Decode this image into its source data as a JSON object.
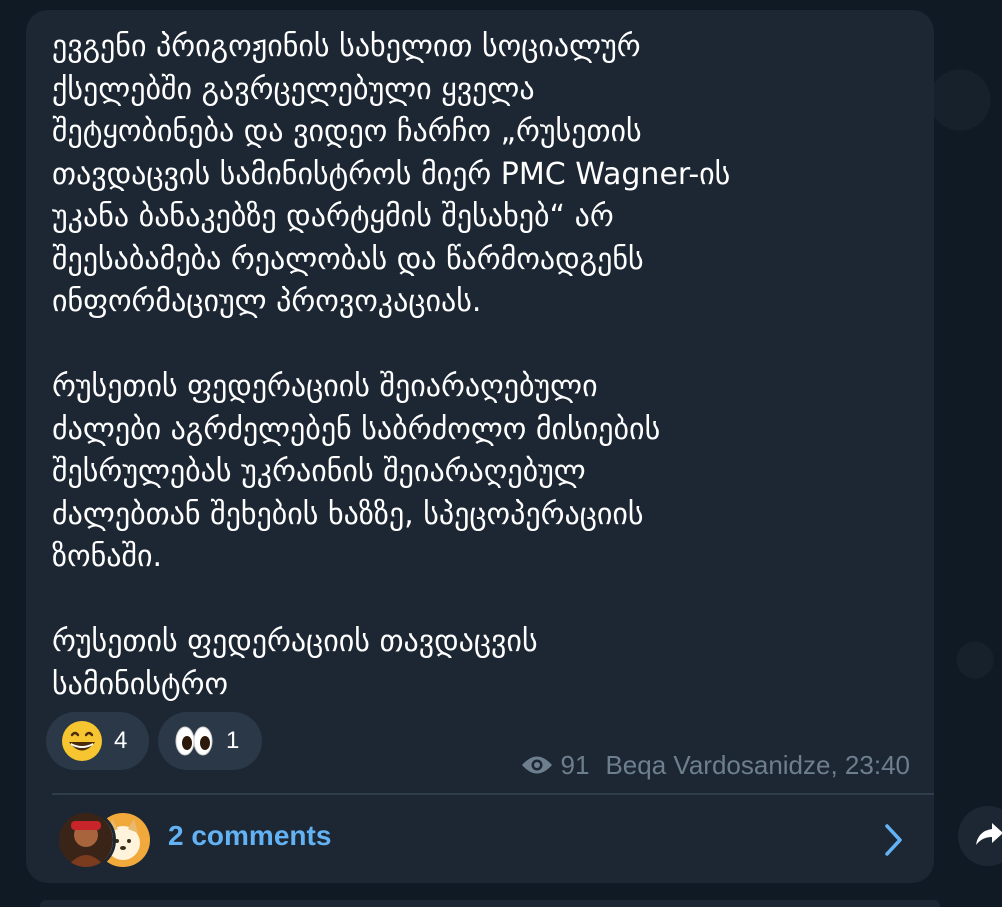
{
  "message": {
    "text": "ევგენი პრიგოჟინის სახელით სოციალურ\nქსელებში გავრცელებული ყველა\nშეტყობინება და ვიდეო ჩარჩო „რუსეთის\nთავდაცვის სამინისტროს მიერ PMC Wagner-ის\nუკანა ბანაკებზე დარტყმის შესახებ“ არ\nშეესაბამება რეალობას და წარმოადგენს\nინფორმაციულ პროვოკაციას.\n\nრუსეთის ფედერაციის შეიარაღებული\nძალები აგრძელებენ საბრძოლო მისიების\nშესრულებას უკრაინის შეიარაღებულ\nძალებთან შეხების ხაზზე, სპეცოპერაციის\nზონაში.\n\nრუსეთის ფედერაციის თავდაცვის\nსამინისტრო"
  },
  "reactions": [
    {
      "icon": "grinning-face-emoji",
      "count": "4"
    },
    {
      "icon": "eyes-emoji",
      "count": "1"
    }
  ],
  "meta": {
    "views": "91",
    "author_time": "Beqa Vardosanidze, 23:40"
  },
  "comments": {
    "label": "2 comments"
  },
  "colors": {
    "bubble": "#1d2733",
    "background": "#0f1a24",
    "accent": "#63b3f4",
    "meta": "#6d7f8f"
  }
}
